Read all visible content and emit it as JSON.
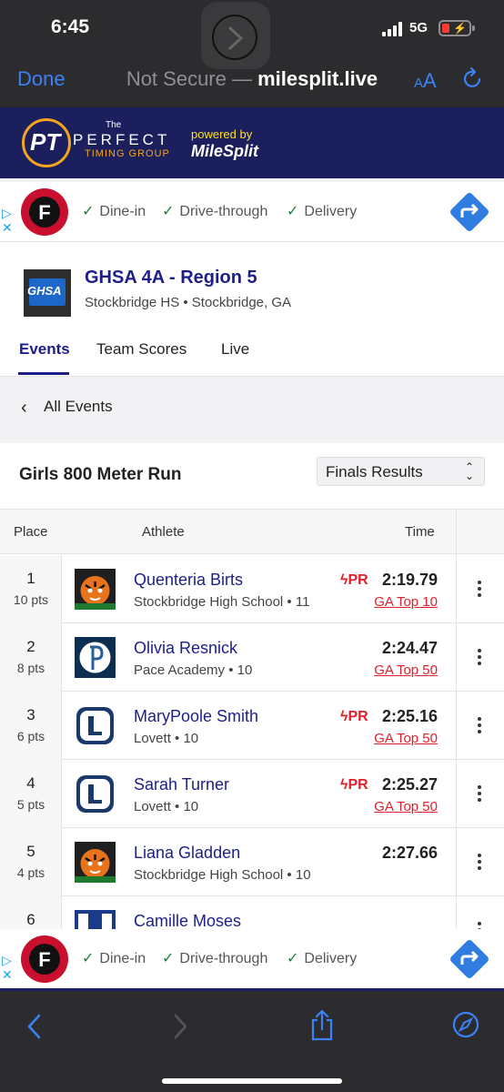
{
  "status_bar": {
    "time": "6:45",
    "network": "5G"
  },
  "browser": {
    "done_label": "Done",
    "not_secure_label": "Not Secure —",
    "host": "milesplit.live",
    "text_size_label_small": "A",
    "text_size_label_large": "A"
  },
  "site_header": {
    "logo_letters": "PT",
    "the_label": "The",
    "perfect_label": "PERFECT",
    "timing_label": "TIMING GROUP",
    "powered_by": "powered by",
    "milesplit_label": "MileSplit"
  },
  "ads": {
    "logo_letter": "F",
    "features": [
      "Dine-in",
      "Drive-through",
      "Delivery"
    ]
  },
  "meet": {
    "logo_text": "GHSA",
    "title": "GHSA 4A - Region 5",
    "subtitle": "Stockbridge HS • Stockbridge, GA",
    "tabs": [
      "Events",
      "Team Scores",
      "Live"
    ]
  },
  "nav": {
    "back_label": "All Events"
  },
  "event": {
    "title": "Girls 800 Meter Run",
    "select_value": "Finals Results"
  },
  "table": {
    "headers": {
      "place": "Place",
      "athlete": "Athlete",
      "time": "Time"
    },
    "pr_label": "PR",
    "rows": [
      {
        "place": "1",
        "pts": "10 pts",
        "name": "Quenteria Birts",
        "school": "Stockbridge High School • 11",
        "time": "2:19.79",
        "pr": true,
        "rank": "GA Top 10",
        "logo": "tiger"
      },
      {
        "place": "2",
        "pts": "8 pts",
        "name": "Olivia Resnick",
        "school": "Pace Academy • 10",
        "time": "2:24.47",
        "pr": false,
        "rank": "GA Top 50",
        "logo": "pace"
      },
      {
        "place": "3",
        "pts": "6 pts",
        "name": "MaryPoole Smith",
        "school": "Lovett • 10",
        "time": "2:25.16",
        "pr": true,
        "rank": "GA Top 50",
        "logo": "lovett"
      },
      {
        "place": "4",
        "pts": "5 pts",
        "name": "Sarah Turner",
        "school": "Lovett • 10",
        "time": "2:25.27",
        "pr": true,
        "rank": "GA Top 50",
        "logo": "lovett"
      },
      {
        "place": "5",
        "pts": "4 pts",
        "name": "Liana Gladden",
        "school": "Stockbridge High School • 10",
        "time": "2:27.66",
        "pr": false,
        "rank": "",
        "logo": "tiger"
      },
      {
        "place": "6",
        "pts": "",
        "name": "Camille Moses",
        "school": "",
        "time": "",
        "pr": false,
        "rank": "",
        "logo": "generic"
      }
    ]
  },
  "colors": {
    "brand_navy": "#1c1f5e",
    "link_blue": "#1c1f8a",
    "pr_red": "#e0202b",
    "accent_blue": "#3b82f6"
  }
}
